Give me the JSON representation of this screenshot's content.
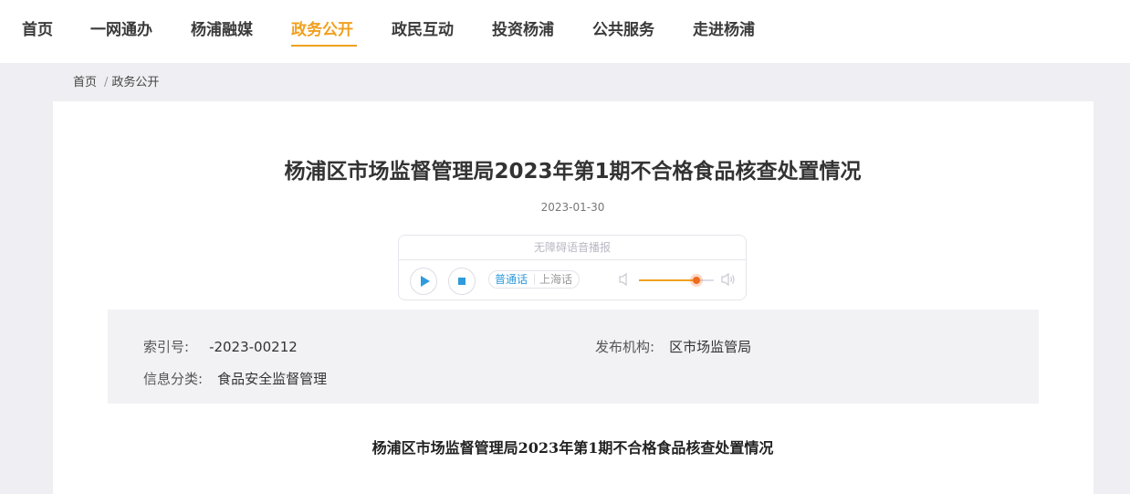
{
  "nav": {
    "items": [
      {
        "label": "首页"
      },
      {
        "label": "一网通办"
      },
      {
        "label": "杨浦融媒"
      },
      {
        "label": "政务公开",
        "active": true
      },
      {
        "label": "政民互动"
      },
      {
        "label": "投资杨浦"
      },
      {
        "label": "公共服务"
      },
      {
        "label": "走进杨浦"
      }
    ]
  },
  "breadcrumb": {
    "home": "首页",
    "separator": "/",
    "current": "政务公开"
  },
  "article": {
    "title": "杨浦区市场监督管理局2023年第1期不合格食品核查处置情况",
    "date": "2023-01-30",
    "body_title": "杨浦区市场监督管理局2023年第1期不合格食品核查处置情况"
  },
  "player": {
    "header": "无障碍语音播报",
    "play_icon": "play-icon",
    "stop_icon": "stop-icon",
    "languages": [
      "普通话",
      "上海话"
    ],
    "selected_language": "普通话",
    "volume_fraction": 0.77
  },
  "meta": {
    "index_label": "索引号:",
    "index_value": "-2023-00212",
    "publisher_label": "发布机构:",
    "publisher_value": "区市场监管局",
    "category_label": "信息分类:",
    "category_value": "食品安全监督管理"
  },
  "colors": {
    "accent": "#f0a01e",
    "player_blue": "#2e9bdd",
    "page_bg": "#efeff3"
  }
}
